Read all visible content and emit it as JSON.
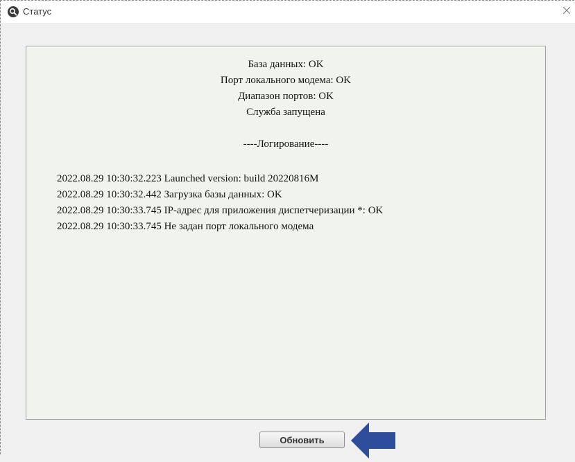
{
  "window": {
    "title": "Статус",
    "app_icon": "app-logo-icon",
    "close_icon": "close-icon"
  },
  "status": {
    "lines": [
      "База данных: OK",
      "Порт локального модема: OK",
      "Диапазон портов: OK",
      "Служба запущена"
    ],
    "log_header": "----Логирование----",
    "log_lines": [
      "2022.08.29 10:30:32.223 Launched version: build 20220816M",
      "2022.08.29 10:30:32.442 Загрузка базы данных: OK",
      "2022.08.29 10:30:33.745 IP-адрес для приложения диспетчеризации *: OK",
      "2022.08.29 10:30:33.745 Не задан порт локального модема"
    ]
  },
  "actions": {
    "refresh_label": "Обновить"
  },
  "annotation": {
    "arrow_icon": "arrow-left-icon",
    "arrow_color": "#2e4d9b"
  }
}
